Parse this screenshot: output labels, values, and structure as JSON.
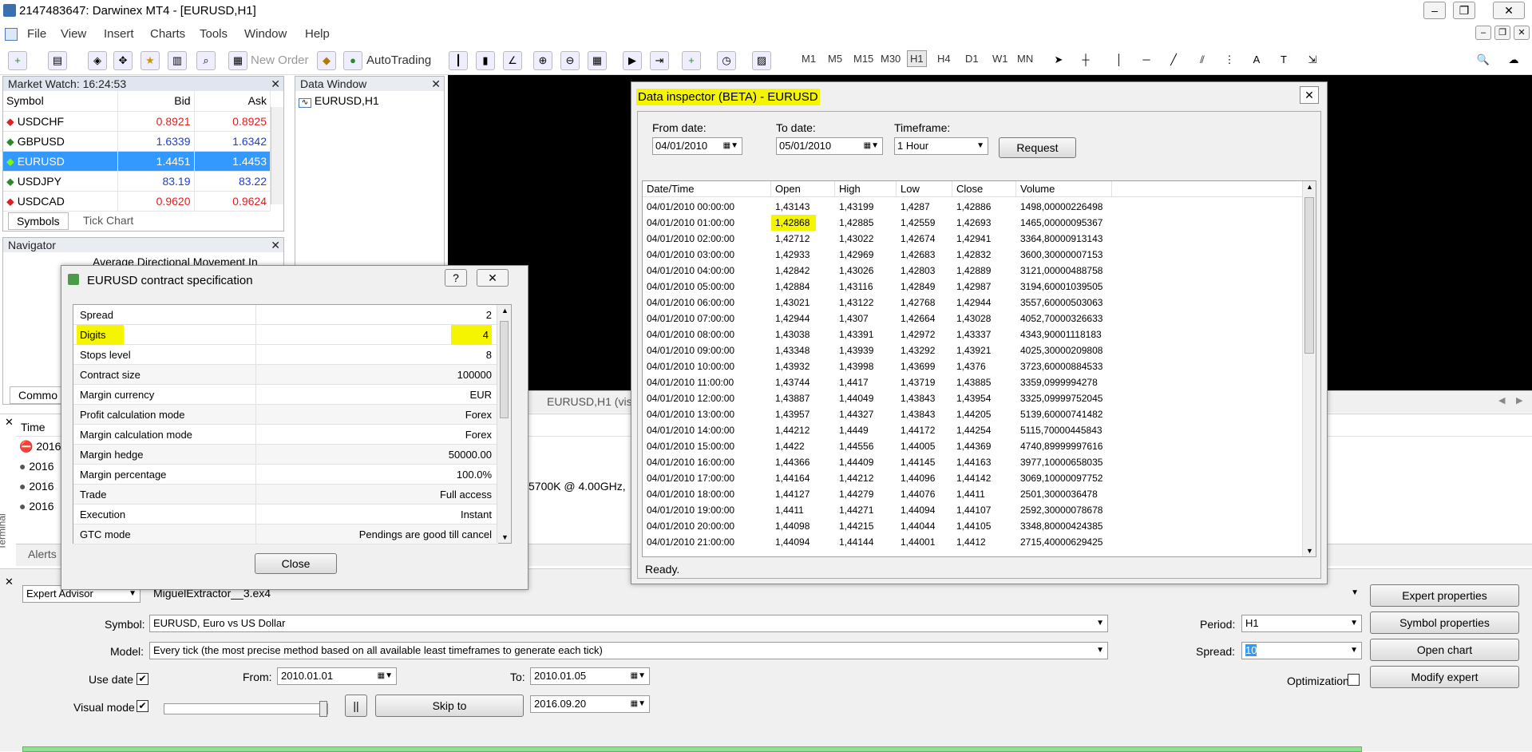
{
  "title_bar": {
    "title": "2147483647: Darwinex MT4 - [EURUSD,H1]"
  },
  "menu": [
    "File",
    "View",
    "Insert",
    "Charts",
    "Tools",
    "Window",
    "Help"
  ],
  "toolbar": {
    "new_order": "New Order",
    "autotrading": "AutoTrading",
    "timeframes": [
      "M1",
      "M5",
      "M15",
      "M30",
      "H1",
      "H4",
      "D1",
      "W1",
      "MN"
    ]
  },
  "market_watch": {
    "title": "Market Watch: 16:24:53",
    "headers": [
      "Symbol",
      "Bid",
      "Ask"
    ],
    "rows": [
      {
        "symbol": "USDCHF",
        "bid": "0.8921",
        "ask": "0.8925"
      },
      {
        "symbol": "GBPUSD",
        "bid": "1.6339",
        "ask": "1.6342"
      },
      {
        "symbol": "EURUSD",
        "bid": "1.4451",
        "ask": "1.4453"
      },
      {
        "symbol": "USDJPY",
        "bid": "83.19",
        "ask": "83.22"
      },
      {
        "symbol": "USDCAD",
        "bid": "0.9620",
        "ask": "0.9624"
      }
    ],
    "tabs": [
      "Symbols",
      "Tick Chart"
    ]
  },
  "data_window": {
    "title": "Data Window",
    "item": "EURUSD,H1"
  },
  "navigator": {
    "title": "Navigator",
    "item": "Average Directional Movement In",
    "tab": "Commo"
  },
  "chart_tab": "EURUSD,H1 (vis",
  "data_inspector": {
    "title": "Data inspector (BETA) -  EURUSD",
    "from_label": "From date:",
    "from_value": "04/01/2010",
    "to_label": "To date:",
    "to_value": "05/01/2010",
    "tf_label": "Timeframe:",
    "tf_value": "1 Hour",
    "request": "Request",
    "columns": [
      "Date/Time",
      "Open",
      "High",
      "Low",
      "Close",
      "Volume"
    ],
    "rows": [
      [
        "04/01/2010 00:00:00",
        "1,43143",
        "1,43199",
        "1,4287",
        "1,42886",
        "1498,00000226498"
      ],
      [
        "04/01/2010 01:00:00",
        "1,42868",
        "1,42885",
        "1,42559",
        "1,42693",
        "1465,00000095367"
      ],
      [
        "04/01/2010 02:00:00",
        "1,42712",
        "1,43022",
        "1,42674",
        "1,42941",
        "3364,80000913143"
      ],
      [
        "04/01/2010 03:00:00",
        "1,42933",
        "1,42969",
        "1,42683",
        "1,42832",
        "3600,30000007153"
      ],
      [
        "04/01/2010 04:00:00",
        "1,42842",
        "1,43026",
        "1,42803",
        "1,42889",
        "3121,00000488758"
      ],
      [
        "04/01/2010 05:00:00",
        "1,42884",
        "1,43116",
        "1,42849",
        "1,42987",
        "3194,60001039505"
      ],
      [
        "04/01/2010 06:00:00",
        "1,43021",
        "1,43122",
        "1,42768",
        "1,42944",
        "3557,60000503063"
      ],
      [
        "04/01/2010 07:00:00",
        "1,42944",
        "1,4307",
        "1,42664",
        "1,43028",
        "4052,70000326633"
      ],
      [
        "04/01/2010 08:00:00",
        "1,43038",
        "1,43391",
        "1,42972",
        "1,43337",
        "4343,90001118183"
      ],
      [
        "04/01/2010 09:00:00",
        "1,43348",
        "1,43939",
        "1,43292",
        "1,43921",
        "4025,30000209808"
      ],
      [
        "04/01/2010 10:00:00",
        "1,43932",
        "1,43998",
        "1,43699",
        "1,4376",
        "3723,60000884533"
      ],
      [
        "04/01/2010 11:00:00",
        "1,43744",
        "1,4417",
        "1,43719",
        "1,43885",
        "3359,0999994278"
      ],
      [
        "04/01/2010 12:00:00",
        "1,43887",
        "1,44049",
        "1,43843",
        "1,43954",
        "3325,09999752045"
      ],
      [
        "04/01/2010 13:00:00",
        "1,43957",
        "1,44327",
        "1,43843",
        "1,44205",
        "5139,60000741482"
      ],
      [
        "04/01/2010 14:00:00",
        "1,44212",
        "1,4449",
        "1,44172",
        "1,44254",
        "5115,70000445843"
      ],
      [
        "04/01/2010 15:00:00",
        "1,4422",
        "1,44556",
        "1,44005",
        "1,44369",
        "4740,89999997616"
      ],
      [
        "04/01/2010 16:00:00",
        "1,44366",
        "1,44409",
        "1,44145",
        "1,44163",
        "3977,10000658035"
      ],
      [
        "04/01/2010 17:00:00",
        "1,44164",
        "1,44212",
        "1,44096",
        "1,44142",
        "3069,10000097752"
      ],
      [
        "04/01/2010 18:00:00",
        "1,44127",
        "1,44279",
        "1,44076",
        "1,4411",
        "2501,3000036478"
      ],
      [
        "04/01/2010 19:00:00",
        "1,4411",
        "1,44271",
        "1,44094",
        "1,44107",
        "2592,30000078678"
      ],
      [
        "04/01/2010 20:00:00",
        "1,44098",
        "1,44215",
        "1,44044",
        "1,44105",
        "3348,80000424385"
      ],
      [
        "04/01/2010 21:00:00",
        "1,44094",
        "1,44144",
        "1,44001",
        "1,4412",
        "2715,40000629425"
      ]
    ],
    "status": "Ready."
  },
  "contract_spec": {
    "title": "EURUSD contract specification",
    "rows": [
      [
        "Spread",
        "2"
      ],
      [
        "Digits",
        "4"
      ],
      [
        "Stops level",
        "8"
      ],
      [
        "Contract size",
        "100000"
      ],
      [
        "Margin currency",
        "EUR"
      ],
      [
        "Profit calculation mode",
        "Forex"
      ],
      [
        "Margin calculation mode",
        "Forex"
      ],
      [
        "Margin hedge",
        "50000.00"
      ],
      [
        "Margin percentage",
        "100.0%"
      ],
      [
        "Trade",
        "Full access"
      ],
      [
        "Execution",
        "Instant"
      ],
      [
        "GTC mode",
        "Pendings are good till cancel"
      ]
    ],
    "close": "Close"
  },
  "terminal": {
    "col_time": "Time",
    "rows": [
      "2016",
      "2016",
      "2016",
      "2016"
    ],
    "cpu_text": "5700K  @ 4.00GHz,",
    "alerts": "Alerts",
    "side_label": "Terminal"
  },
  "tester": {
    "type": "Expert Advisor",
    "expert": "MiguelExtractor__3.ex4",
    "symbol_label": "Symbol:",
    "symbol": "EURUSD, Euro vs US Dollar",
    "model_label": "Model:",
    "model": "Every tick (the most precise method based on all available least timeframes to generate each tick)",
    "use_date": "Use date",
    "from_label": "From:",
    "from": "2010.01.01",
    "to_label": "To:",
    "to": "2010.01.05",
    "visual_mode": "Visual mode",
    "skip_to": "Skip to",
    "skip_date": "2016.09.20",
    "pause": "||",
    "period_label": "Period:",
    "period": "H1",
    "spread_label": "Spread:",
    "spread": "10",
    "optimization": "Optimization",
    "buttons": [
      "Expert properties",
      "Symbol properties",
      "Open chart",
      "Modify expert"
    ]
  }
}
